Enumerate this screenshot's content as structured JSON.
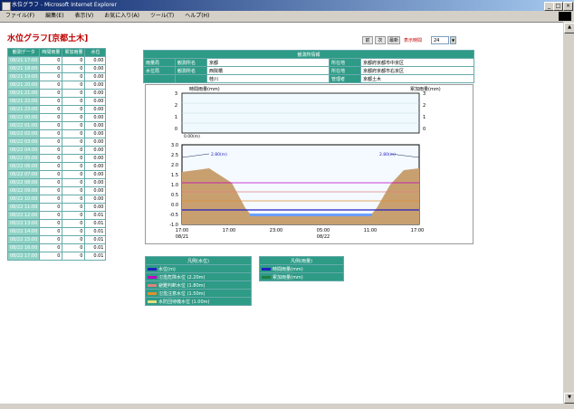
{
  "window": {
    "title": "水位グラフ - Microsoft Internet Explorer",
    "min": "_",
    "max": "□",
    "close": "×"
  },
  "menu": [
    "ファイル(F)",
    "編集(E)",
    "表示(V)",
    "お気に入り(A)",
    "ツール(T)",
    "ヘルプ(H)"
  ],
  "page": {
    "title": "水位グラフ[京都土木]"
  },
  "toolbar": {
    "btn1": "前",
    "btn2": "次",
    "btn3": "最新",
    "interval_label": "表示時間",
    "interval_value": "24"
  },
  "data_table": {
    "headers": [
      "観測データ",
      "時間雨量",
      "累加雨量",
      "水位"
    ],
    "rows": [
      {
        "time": "08/21 17:00",
        "r1": "0",
        "r2": "0",
        "wl": "0.00"
      },
      {
        "time": "08/21 18:00",
        "r1": "0",
        "r2": "0",
        "wl": "0.00"
      },
      {
        "time": "08/21 19:00",
        "r1": "0",
        "r2": "0",
        "wl": "0.00"
      },
      {
        "time": "08/21 20:00",
        "r1": "0",
        "r2": "0",
        "wl": "0.00"
      },
      {
        "time": "08/21 21:00",
        "r1": "0",
        "r2": "0",
        "wl": "0.00"
      },
      {
        "time": "08/21 22:00",
        "r1": "0",
        "r2": "0",
        "wl": "0.00"
      },
      {
        "time": "08/21 23:00",
        "r1": "0",
        "r2": "0",
        "wl": "0.00"
      },
      {
        "time": "08/22 00:00",
        "r1": "0",
        "r2": "0",
        "wl": "0.00"
      },
      {
        "time": "08/22 01:00",
        "r1": "0",
        "r2": "0",
        "wl": "0.00"
      },
      {
        "time": "08/22 02:00",
        "r1": "0",
        "r2": "0",
        "wl": "0.00"
      },
      {
        "time": "08/22 03:00",
        "r1": "0",
        "r2": "0",
        "wl": "0.00"
      },
      {
        "time": "08/22 04:00",
        "r1": "0",
        "r2": "0",
        "wl": "0.00"
      },
      {
        "time": "08/22 05:00",
        "r1": "0",
        "r2": "0",
        "wl": "0.00"
      },
      {
        "time": "08/22 06:00",
        "r1": "0",
        "r2": "0",
        "wl": "0.00"
      },
      {
        "time": "08/22 07:00",
        "r1": "0",
        "r2": "0",
        "wl": "0.00"
      },
      {
        "time": "08/22 08:00",
        "r1": "0",
        "r2": "0",
        "wl": "0.00"
      },
      {
        "time": "08/22 09:00",
        "r1": "0",
        "r2": "0",
        "wl": "0.00"
      },
      {
        "time": "08/22 10:00",
        "r1": "0",
        "r2": "0",
        "wl": "0.00"
      },
      {
        "time": "08/22 11:00",
        "r1": "0",
        "r2": "0",
        "wl": "0.00"
      },
      {
        "time": "08/22 12:00",
        "r1": "0",
        "r2": "0",
        "wl": "0.01"
      },
      {
        "time": "08/22 13:00",
        "r1": "0",
        "r2": "0",
        "wl": "0.01"
      },
      {
        "time": "08/22 14:00",
        "r1": "0",
        "r2": "0",
        "wl": "0.01"
      },
      {
        "time": "08/22 15:00",
        "r1": "0",
        "r2": "0",
        "wl": "0.01"
      },
      {
        "time": "08/22 16:00",
        "r1": "0",
        "r2": "0",
        "wl": "0.01"
      },
      {
        "time": "08/22 17:00",
        "r1": "0",
        "r2": "0",
        "wl": "0.01"
      }
    ]
  },
  "station_info": {
    "header": "観測所情報",
    "r1": [
      "雨量局",
      "観測所名",
      "京都",
      "所在地",
      "京都府京都市中京区"
    ],
    "r2": [
      "水位局",
      "観測所名",
      "西院橋",
      "所在地",
      "京都府京都市右京区"
    ],
    "r3": [
      "",
      "",
      "桂川",
      "管理者",
      "京都土木"
    ]
  },
  "rain_chart": {
    "left_label": "時間雨量(mm)",
    "right_label": "累加雨量(mm)",
    "left_ticks": [
      "3",
      "2",
      "1",
      "0"
    ],
    "right_ticks": [
      "3",
      "2",
      "1",
      "0"
    ],
    "tag": "0.00(m)"
  },
  "level_chart": {
    "y_ticks": [
      "3.0",
      "2.5",
      "2.0",
      "1.5",
      "1.0",
      "0.5",
      "0.0",
      "-0.5",
      "-1.0"
    ],
    "x_ticks": [
      {
        "t": "17:00",
        "d": "08/21"
      },
      {
        "t": "17:00",
        "d": ""
      },
      {
        "t": "23:00",
        "d": ""
      },
      {
        "t": "05:00",
        "d": "08/22"
      },
      {
        "t": "11:00",
        "d": ""
      },
      {
        "t": "17:00",
        "d": ""
      }
    ],
    "left_bank": "2.80(m)",
    "right_bank": "2.80(m)"
  },
  "legend_level": {
    "header": "凡例(水位)",
    "items": [
      {
        "color": "#2020c0",
        "label": "水位(m)"
      },
      {
        "color": "#c000c0",
        "label": "氾濫危険水位 (2.20m)"
      },
      {
        "color": "#e08080",
        "label": "避難判断水位 (1.80m)"
      },
      {
        "color": "#e09030",
        "label": "氾濫注意水位 (1.50m)"
      },
      {
        "color": "#e0e080",
        "label": "水防団待機水位 (1.00m)"
      }
    ]
  },
  "legend_rain": {
    "header": "凡例(雨量)",
    "items": [
      {
        "color": "#2020c0",
        "label": "時間雨量(mm)"
      },
      {
        "color": "#208040",
        "label": "累加雨量(mm)"
      }
    ]
  },
  "colors": {
    "teal": "#2e9b86",
    "bank": "#c8a070",
    "water": "#6080e0",
    "danger": "#c000c0"
  }
}
